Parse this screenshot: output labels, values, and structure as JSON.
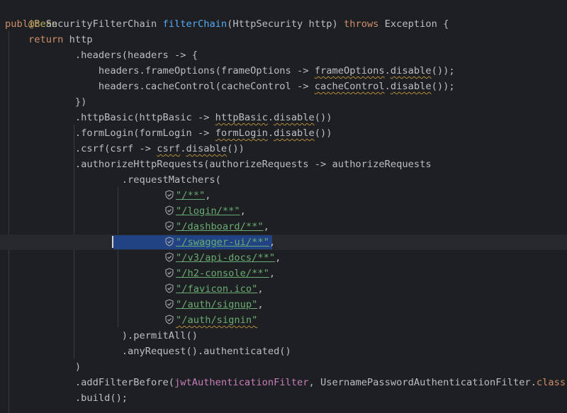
{
  "colors": {
    "background": "#1e1f22",
    "default_text": "#bcbec4",
    "keyword": "#cf8e6d",
    "annotation": "#b3ae60",
    "method_declaration": "#56a8f5",
    "string": "#6aab73",
    "field": "#c77dbb",
    "selection": "#214283",
    "warning_underline": "#b38c39"
  },
  "icons": {
    "url_mapping": "shield-check-icon"
  },
  "code": {
    "l1": {
      "annotation": "@Bean"
    },
    "l2": {
      "kw_public": "public",
      "type": " SecurityFilterChain ",
      "method": "filterChain",
      "params": "(HttpSecurity http) ",
      "kw_throws": "throws",
      "rest": " Exception {"
    },
    "l3": {
      "indent": "    ",
      "kw_return": "return",
      "rest": " http"
    },
    "l4": {
      "text": "            .headers(headers -> {"
    },
    "l5": {
      "a": "                headers.frameOptions(frameOptions -> ",
      "err1": "frameOptions",
      "b": ".",
      "err2": "disable",
      "c": "());"
    },
    "l6": {
      "a": "                headers.cacheControl(cacheControl -> ",
      "err1": "cacheControl",
      "b": ".",
      "err2": "disable",
      "c": "());"
    },
    "l7": {
      "text": "            })"
    },
    "l8": {
      "a": "            .httpBasic(httpBasic -> ",
      "err1": "httpBasic",
      "b": ".",
      "err2": "disable",
      "c": "())"
    },
    "l9": {
      "a": "            .formLogin(formLogin -> ",
      "err1": "formLogin",
      "b": ".",
      "err2": "disable",
      "c": "())"
    },
    "l10": {
      "a": "            .csrf(csrf -> ",
      "err1": "csrf",
      "b": ".",
      "err2": "disable",
      "c": "())"
    },
    "l11": {
      "text": "            .authorizeHttpRequests(authorizeRequests -> authorizeRequests"
    },
    "l12": {
      "text": "                    .requestMatchers("
    },
    "matchers": [
      {
        "value": "\"/**\"",
        "suffix": ","
      },
      {
        "value": "\"/login/**\"",
        "suffix": ","
      },
      {
        "value": "\"/dashboard/**\"",
        "suffix": ","
      },
      {
        "value": "\"/swagger-ui/**\"",
        "suffix": ","
      },
      {
        "value": "\"/v3/api-docs/**\"",
        "suffix": ","
      },
      {
        "value": "\"/h2-console/**\"",
        "suffix": ","
      },
      {
        "value": "\"/favicon.ico\"",
        "suffix": ","
      },
      {
        "value": "\"/auth/signup\"",
        "suffix": ","
      },
      {
        "value": "\"/auth/signin\"",
        "suffix": ""
      }
    ],
    "l22": {
      "text": "                    ).permitAll()"
    },
    "l23": {
      "text": "                    .anyRequest().authenticated()"
    },
    "l24": {
      "text": "            )"
    },
    "l25": {
      "a": "            .addFilterBefore(",
      "field": "jwtAuthenticationFilter",
      "b": ", UsernamePasswordAuthenticationFilter.",
      "kw_class": "class",
      "c": ")"
    },
    "l26": {
      "text": "            .build();"
    }
  }
}
